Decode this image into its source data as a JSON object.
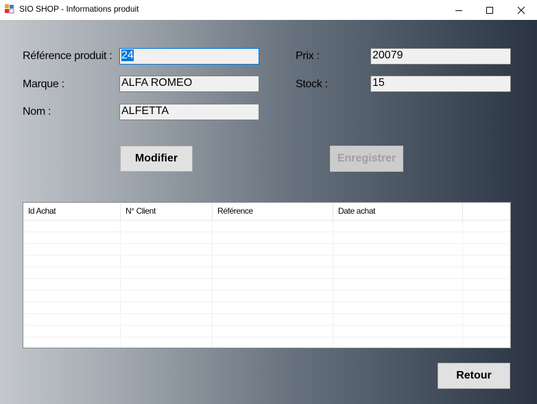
{
  "window": {
    "title": "SIO SHOP - Informations produit"
  },
  "form": {
    "reference_label": "Référence produit :",
    "reference_value": "24",
    "marque_label": "Marque :",
    "marque_value": "ALFA ROMEO",
    "nom_label": "Nom :",
    "nom_value": "ALFETTA",
    "prix_label": "Prix :",
    "prix_value": "20079",
    "stock_label": "Stock :",
    "stock_value": "15"
  },
  "buttons": {
    "modifier": "Modifier",
    "enregistrer": "Enregistrer",
    "retour": "Retour"
  },
  "table": {
    "columns": [
      "Id Achat",
      "N° Client",
      "Référence",
      "Date achat"
    ],
    "rows": []
  },
  "colors": {
    "gradient_left": "#c4c8cc",
    "gradient_right": "#2a3443",
    "selection": "#0078d7"
  }
}
